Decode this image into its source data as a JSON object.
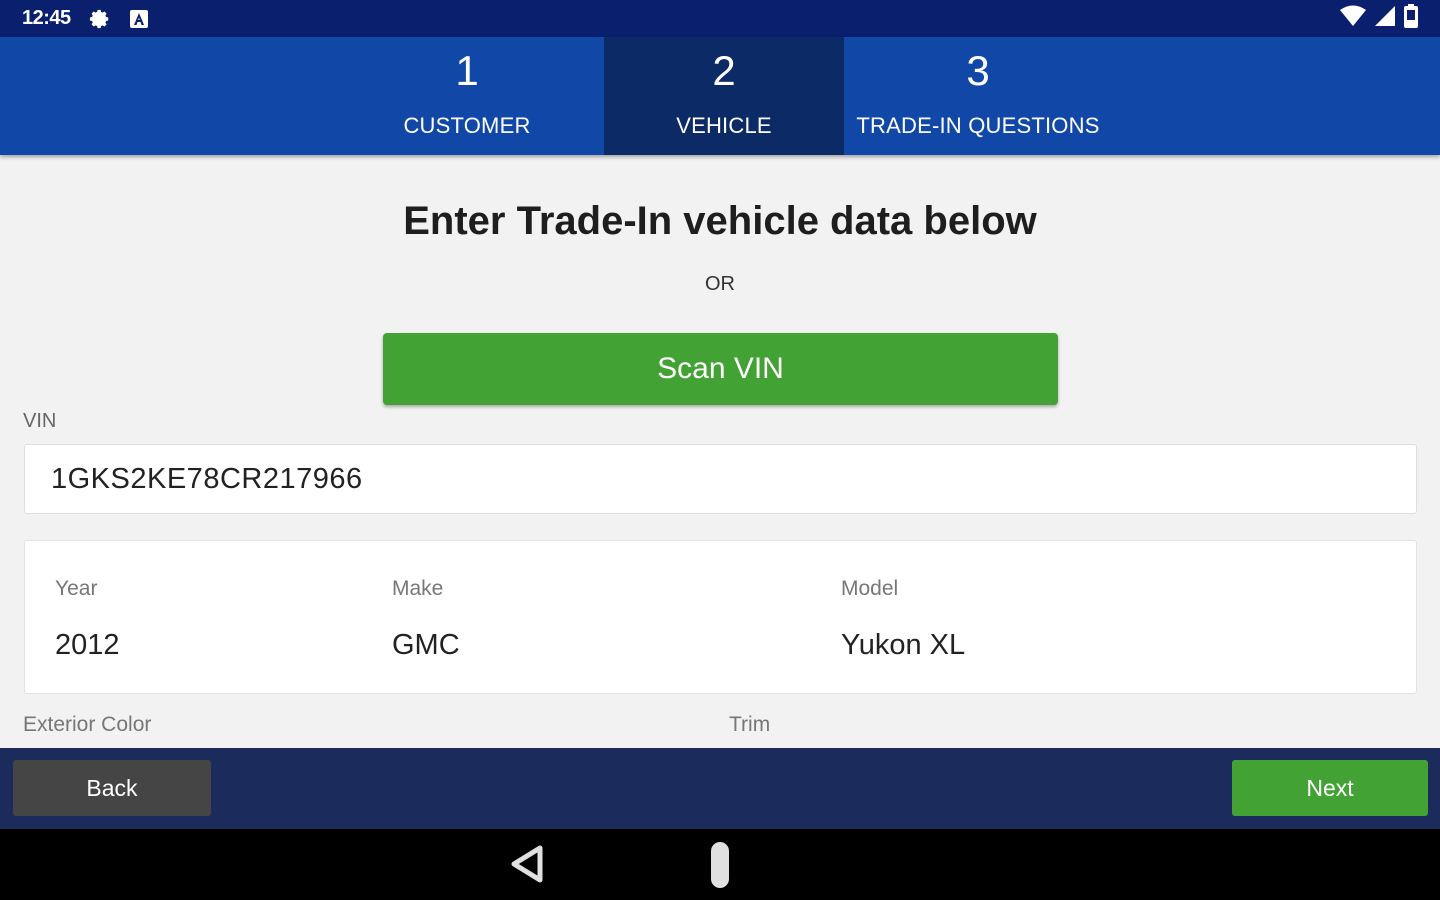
{
  "status_bar": {
    "time": "12:45",
    "left_icons": [
      "gear-icon",
      "a-box-icon"
    ],
    "right_icons": [
      "wifi-icon",
      "signal-icon",
      "battery-icon"
    ]
  },
  "steps": [
    {
      "number": "1",
      "label": "CUSTOMER",
      "active": false
    },
    {
      "number": "2",
      "label": "VEHICLE",
      "active": true
    },
    {
      "number": "3",
      "label": "TRADE-IN QUESTIONS",
      "active": false
    }
  ],
  "main": {
    "heading": "Enter Trade-In vehicle data below",
    "or_text": "OR",
    "scan_button": "Scan VIN",
    "vin": {
      "label": "VIN",
      "value": "1GKS2KE78CR217966"
    },
    "vehicle": {
      "year": {
        "label": "Year",
        "value": "2012"
      },
      "make": {
        "label": "Make",
        "value": "GMC"
      },
      "model": {
        "label": "Model",
        "value": "Yukon XL"
      }
    },
    "exterior_color_label": "Exterior Color",
    "trim_label": "Trim"
  },
  "footer": {
    "back": "Back",
    "next": "Next"
  },
  "colors": {
    "status_bar": "#0a1f6e",
    "steps_bar": "#1148a8",
    "active_step": "#0c2a66",
    "primary_green": "#43a234",
    "footer_bar": "#1a2b5c",
    "back_button": "#454545"
  }
}
